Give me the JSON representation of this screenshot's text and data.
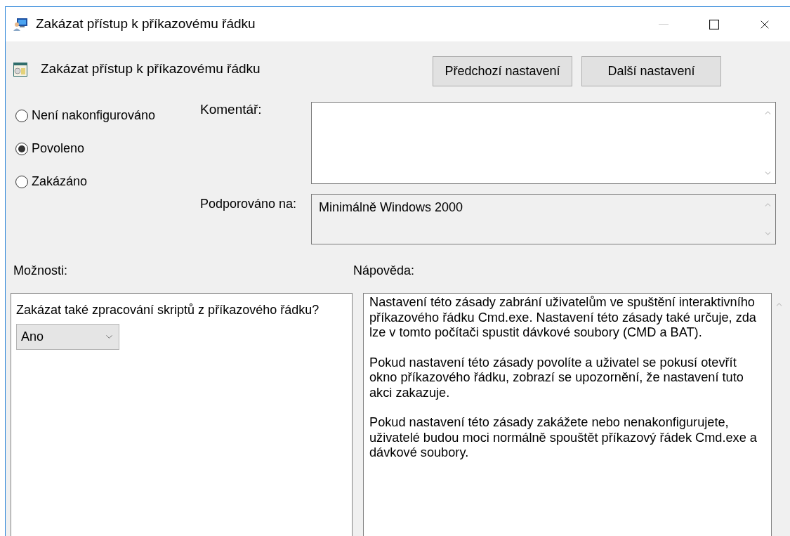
{
  "window": {
    "title": "Zakázat přístup k příkazovému řádku",
    "controls": [
      {
        "kind": "minimize",
        "disabled": true
      },
      {
        "kind": "maximize",
        "disabled": false
      },
      {
        "kind": "close",
        "disabled": false
      }
    ]
  },
  "setting": {
    "title": "Zakázat přístup k příkazovému řádku"
  },
  "buttons": [
    "Předchozí nastavení",
    "Další nastavení"
  ],
  "state_options": [
    {
      "label": "Není nakonfigurováno",
      "selected": false
    },
    {
      "label": "Povoleno",
      "selected": true
    },
    {
      "label": "Zakázáno",
      "selected": false
    }
  ],
  "comment": {
    "label": "Komentář:"
  },
  "supported_on": {
    "label": "Podporováno na:",
    "value": "Minimálně Windows 2000"
  },
  "options": {
    "label": "Možnosti:",
    "question": "Zakázat také zpracování skriptů z příkazového řádku?",
    "dropdown_value": "Ano"
  },
  "help": {
    "label": "Nápověda:",
    "paragraphs": [
      "Nastavení této zásady zabrání uživatelům ve spuštění interaktivního příkazového řádku Cmd.exe.  Nastavení této zásady také určuje, zda lze v tomto počítači spustit dávkové soubory (CMD a BAT).",
      "Pokud nastavení této zásady povolíte a uživatel se pokusí otevřít okno příkazového řádku, zobrazí se upozornění, že nastavení tuto akci zakazuje.",
      "Pokud nastavení této zásady zakážete nebo nenakonfigurujete, uživatelé budou moci normálně spouštět příkazový řádek Cmd.exe a dávkové soubory."
    ]
  }
}
